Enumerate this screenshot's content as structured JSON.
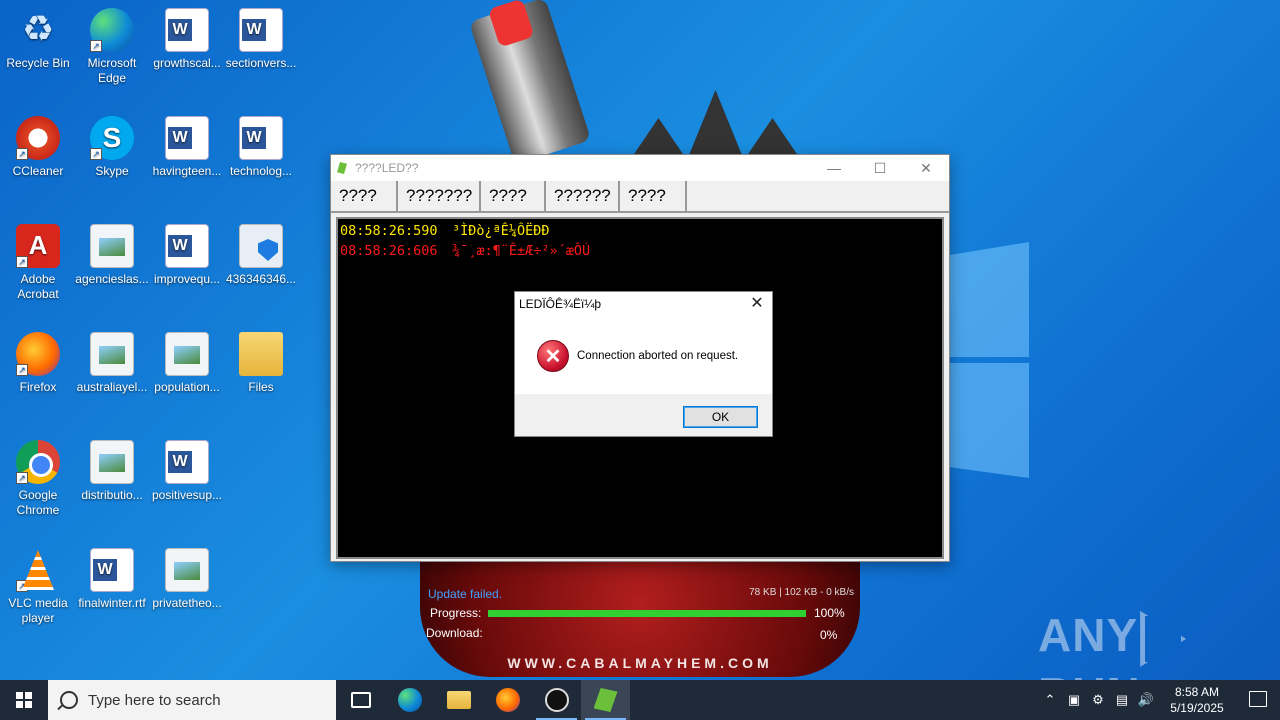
{
  "desktop": {
    "icons": [
      {
        "label": "Recycle Bin"
      },
      {
        "label": "Microsoft Edge"
      },
      {
        "label": "growthscal..."
      },
      {
        "label": "sectionvers..."
      },
      {
        "label": "CCleaner"
      },
      {
        "label": "Skype"
      },
      {
        "label": "havingteen..."
      },
      {
        "label": "technolog..."
      },
      {
        "label": "Adobe Acrobat"
      },
      {
        "label": "agencieslas..."
      },
      {
        "label": "improvequ..."
      },
      {
        "label": "436346346..."
      },
      {
        "label": "Firefox"
      },
      {
        "label": "australiayel..."
      },
      {
        "label": "population..."
      },
      {
        "label": "Files"
      },
      {
        "label": "Google Chrome"
      },
      {
        "label": "distributio..."
      },
      {
        "label": "positivesup..."
      },
      {
        "label": "VLC media player"
      },
      {
        "label": "finalwinter.rtf"
      },
      {
        "label": "privatetheo..."
      }
    ]
  },
  "launcher": {
    "status": "Update failed.",
    "stats": "78 KB | 102 KB - 0 kB/s",
    "progress_label": "Progress:",
    "progress_value": "100%",
    "progress_fraction": 1.0,
    "download_label": "Download:",
    "download_value": "0%",
    "site": "WWW.CABALMAYHEM.COM"
  },
  "app_window": {
    "title": "????LED??",
    "tabs": [
      {
        "label": "????"
      },
      {
        "label": "???????"
      },
      {
        "label": "????"
      },
      {
        "label": "??????"
      },
      {
        "label": "????"
      }
    ],
    "log": [
      {
        "time": "08:58:26:590",
        "text": "³ÌÐò¿ªÊ¼ÔËÐÐ",
        "color": "yellow"
      },
      {
        "time": "08:58:26:606",
        "text": "¾¯¸æ:¶¨Ê±Æ÷²»´æÔÚ",
        "color": "red"
      }
    ]
  },
  "dialog": {
    "title": "LEDÏÔÊ¾Ëï¼þ",
    "message": "Connection aborted on request.",
    "ok_label": "OK"
  },
  "watermark": {
    "left": "ANY",
    "right": "RUN"
  },
  "taskbar": {
    "search_placeholder": "Type here to search",
    "time": "8:58 AM",
    "date": "5/19/2025"
  },
  "colors": {
    "desktop_blue": "#0f6fd1",
    "taskbar": "#1f2a38",
    "log_yellow": "#ffe600",
    "log_red": "#ff1a1a",
    "progress_green": "#2fd02f",
    "status_blue": "#3ea2ff"
  }
}
